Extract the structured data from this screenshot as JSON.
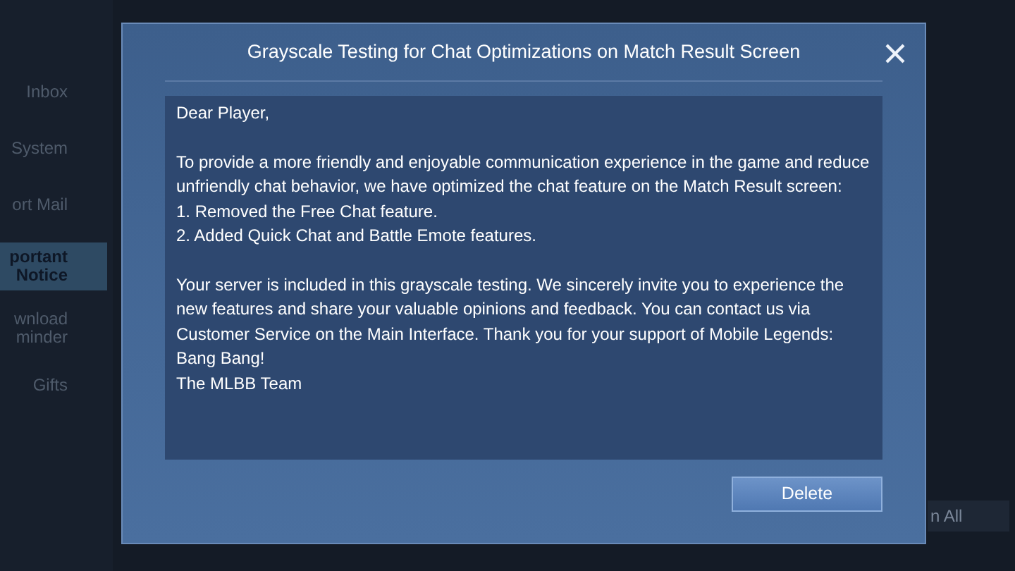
{
  "sidebar": {
    "items": [
      {
        "label": "Inbox",
        "selected": false
      },
      {
        "label": "System",
        "selected": false
      },
      {
        "label": "ort Mail",
        "selected": false
      },
      {
        "label": "portant Notice",
        "selected": true
      },
      {
        "label": "wnload minder",
        "selected": false
      },
      {
        "label": "Gifts",
        "selected": false
      }
    ]
  },
  "background_button": "n All",
  "dialog": {
    "title": "Grayscale Testing for Chat Optimizations on Match Result Screen",
    "blocks": [
      [
        "Dear Player,"
      ],
      [
        "To provide a more friendly and enjoyable communication experience in the game and reduce unfriendly chat behavior, we have optimized the chat feature on the Match Result screen:",
        "1. Removed the Free Chat feature.",
        "2. Added Quick Chat and Battle Emote features."
      ],
      [
        "Your server is included in this grayscale testing. We sincerely invite you to experience the new features and share your valuable opinions and feedback. You can contact us via Customer Service on the Main Interface. Thank you for your support of Mobile Legends: Bang Bang!",
        "The MLBB Team"
      ]
    ],
    "button": "Delete"
  }
}
